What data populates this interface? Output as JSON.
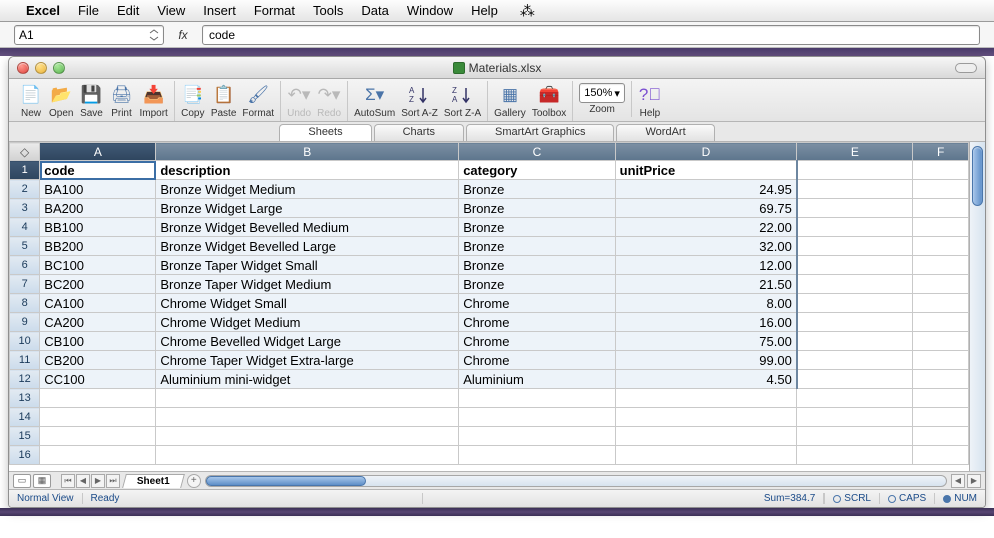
{
  "menubar": {
    "items": [
      "Excel",
      "File",
      "Edit",
      "View",
      "Insert",
      "Format",
      "Tools",
      "Data",
      "Window",
      "Help"
    ]
  },
  "formula": {
    "cellRef": "A1",
    "fxLabel": "fx",
    "value": "code"
  },
  "window": {
    "title": "Materials.xlsx"
  },
  "toolbar": {
    "new": "New",
    "open": "Open",
    "save": "Save",
    "print": "Print",
    "import": "Import",
    "copy": "Copy",
    "paste": "Paste",
    "format": "Format",
    "undo": "Undo",
    "redo": "Redo",
    "autosum": "AutoSum",
    "sortAZ": "Sort A-Z",
    "sortZA": "Sort Z-A",
    "gallery": "Gallery",
    "toolbox": "Toolbox",
    "zoomLabel": "Zoom",
    "zoomValue": "150%",
    "help": "Help"
  },
  "subtabs": [
    "Sheets",
    "Charts",
    "SmartArt Graphics",
    "WordArt"
  ],
  "columns": [
    "A",
    "B",
    "C",
    "D",
    "E",
    "F"
  ],
  "headers": {
    "code": "code",
    "description": "description",
    "category": "category",
    "unitPrice": "unitPrice"
  },
  "rows": [
    {
      "code": "BA100",
      "description": "Bronze Widget Medium",
      "category": "Bronze",
      "unitPrice": "24.95"
    },
    {
      "code": "BA200",
      "description": "Bronze Widget Large",
      "category": "Bronze",
      "unitPrice": "69.75"
    },
    {
      "code": "BB100",
      "description": "Bronze Widget Bevelled Medium",
      "category": "Bronze",
      "unitPrice": "22.00"
    },
    {
      "code": "BB200",
      "description": "Bronze Widget Bevelled Large",
      "category": "Bronze",
      "unitPrice": "32.00"
    },
    {
      "code": "BC100",
      "description": "Bronze Taper Widget Small",
      "category": "Bronze",
      "unitPrice": "12.00"
    },
    {
      "code": "BC200",
      "description": "Bronze Taper Widget Medium",
      "category": "Bronze",
      "unitPrice": "21.50"
    },
    {
      "code": "CA100",
      "description": "Chrome Widget Small",
      "category": "Chrome",
      "unitPrice": "8.00"
    },
    {
      "code": "CA200",
      "description": "Chrome Widget Medium",
      "category": "Chrome",
      "unitPrice": "16.00"
    },
    {
      "code": "CB100",
      "description": "Chrome Bevelled Widget Large",
      "category": "Chrome",
      "unitPrice": "75.00"
    },
    {
      "code": "CB200",
      "description": "Chrome Taper Widget Extra-large",
      "category": "Chrome",
      "unitPrice": "99.00"
    },
    {
      "code": "CC100",
      "description": "Aluminium mini-widget",
      "category": "Aluminium",
      "unitPrice": "4.50"
    }
  ],
  "emptyRows": [
    13,
    14,
    15,
    16
  ],
  "sheetTabs": {
    "active": "Sheet1"
  },
  "status": {
    "view": "Normal View",
    "ready": "Ready",
    "sum": "Sum=384.7",
    "scrl": "SCRL",
    "caps": "CAPS",
    "num": "NUM"
  }
}
